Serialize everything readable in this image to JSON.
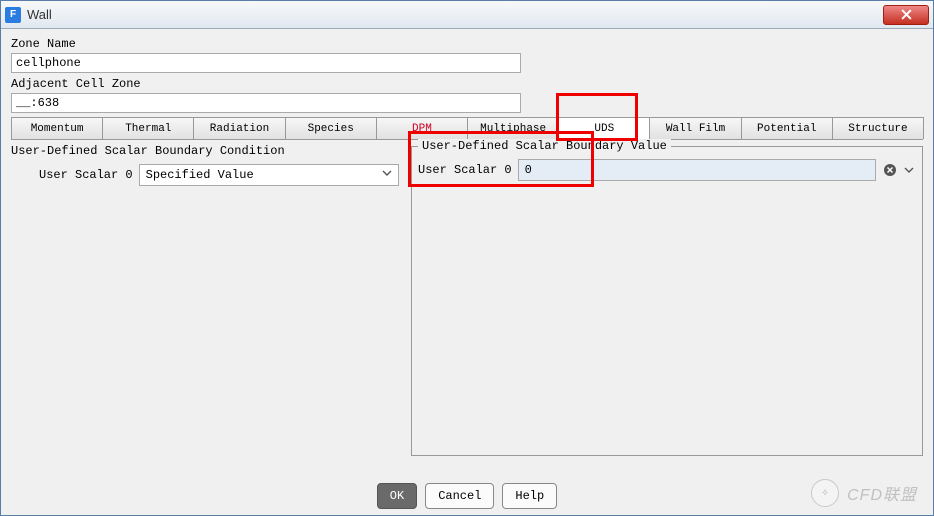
{
  "window": {
    "title": "Wall"
  },
  "zone": {
    "label": "Zone Name",
    "value": "cellphone",
    "adj_label": "Adjacent Cell Zone",
    "adj_value": "__:638"
  },
  "tabs": [
    {
      "label": "Momentum"
    },
    {
      "label": "Thermal"
    },
    {
      "label": "Radiation"
    },
    {
      "label": "Species"
    },
    {
      "label": "DPM"
    },
    {
      "label": "Multiphase"
    },
    {
      "label": "UDS"
    },
    {
      "label": "Wall Film"
    },
    {
      "label": "Potential"
    },
    {
      "label": "Structure"
    }
  ],
  "left": {
    "heading": "User-Defined Scalar Boundary Condition",
    "row_label": "User Scalar 0",
    "dropdown_value": "Specified Value"
  },
  "right": {
    "heading": "User-Defined Scalar Boundary Value",
    "row_label": "User Scalar 0",
    "value": "0"
  },
  "buttons": {
    "ok": "OK",
    "cancel": "Cancel",
    "help": "Help"
  },
  "watermark": {
    "text": "CFD联盟"
  },
  "highlight": {
    "tab_index": 6
  }
}
